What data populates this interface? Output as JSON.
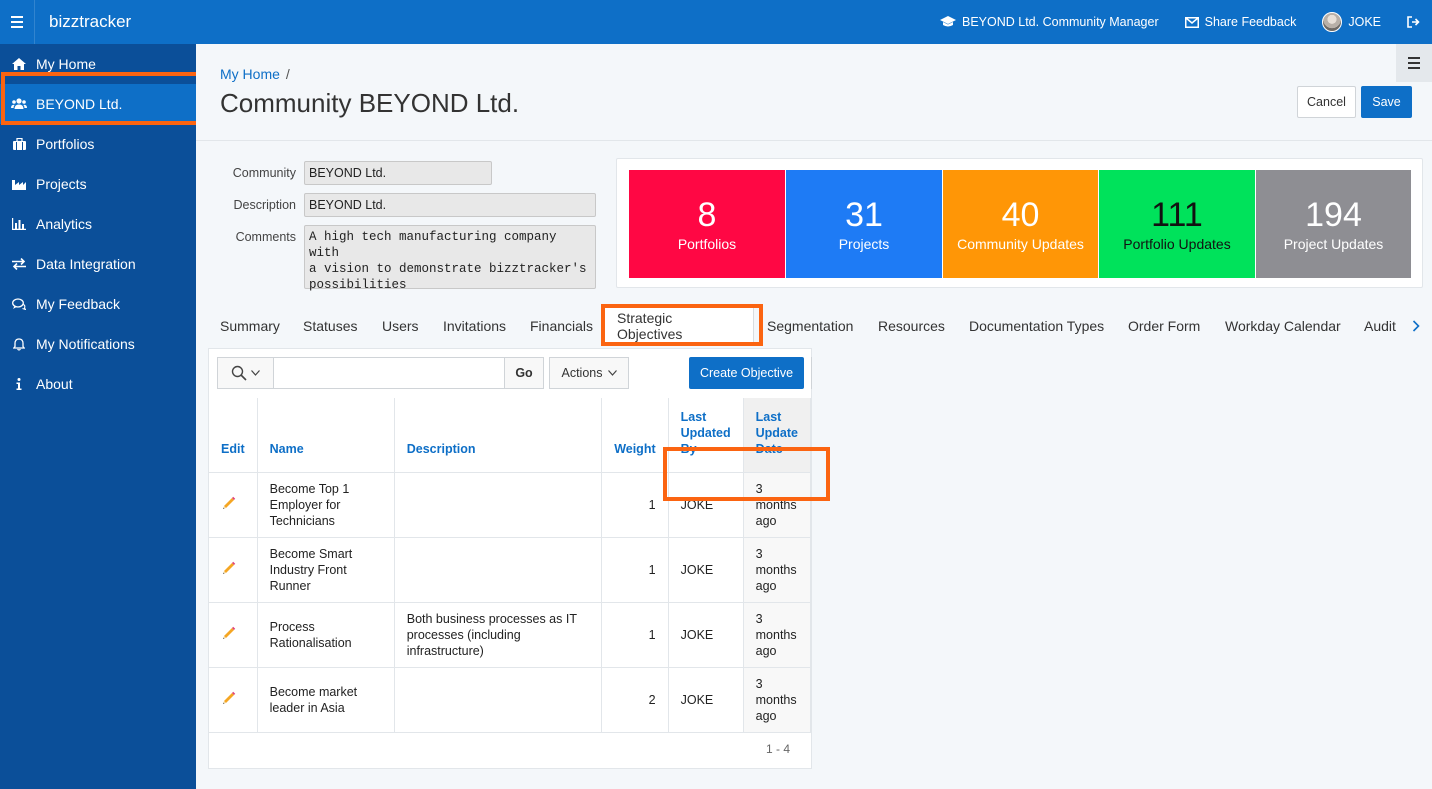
{
  "topbar": {
    "brand": "bizztracker",
    "role": "BEYOND Ltd. Community Manager",
    "feedback": "Share Feedback",
    "user": "JOKE"
  },
  "sidebar": {
    "items": [
      {
        "label": "My Home",
        "icon": "home-icon"
      },
      {
        "label": "BEYOND Ltd.",
        "icon": "users-icon"
      },
      {
        "label": "Portfolios",
        "icon": "briefcase-icon"
      },
      {
        "label": "Projects",
        "icon": "factory-icon"
      },
      {
        "label": "Analytics",
        "icon": "bar-chart-icon"
      },
      {
        "label": "Data Integration",
        "icon": "exchange-icon"
      },
      {
        "label": "My Feedback",
        "icon": "comments-icon"
      },
      {
        "label": "My Notifications",
        "icon": "bell-icon"
      },
      {
        "label": "About",
        "icon": "info-icon"
      }
    ]
  },
  "header": {
    "breadcrumb": "My Home",
    "breadcrumb_sep": "/",
    "title": "Community BEYOND Ltd.",
    "cancel": "Cancel",
    "save": "Save"
  },
  "form": {
    "community_label": "Community",
    "community_value": "BEYOND Ltd.",
    "description_label": "Description",
    "description_value": "BEYOND Ltd.",
    "comments_label": "Comments",
    "comments_value": "A high tech manufacturing company with\na vision to demonstrate bizztracker's\npossibilities"
  },
  "stats": [
    {
      "num": "8",
      "label": "Portfolios",
      "color": "#ff0744"
    },
    {
      "num": "31",
      "label": "Projects",
      "color": "#1e7bf5"
    },
    {
      "num": "40",
      "label": "Community Updates",
      "color": "#ff9606"
    },
    {
      "num": "111",
      "label": "Portfolio Updates",
      "color": "#00e25b"
    },
    {
      "num": "194",
      "label": "Project Updates",
      "color": "#8e8e93"
    }
  ],
  "tabs": [
    "Summary",
    "Statuses",
    "Users",
    "Invitations",
    "Financials",
    "Strategic Objectives",
    "Segmentation",
    "Resources",
    "Documentation Types",
    "Order Form",
    "Workday Calendar",
    "Audit"
  ],
  "report": {
    "go": "Go",
    "actions": "Actions",
    "create": "Create Objective",
    "columns": {
      "edit": "Edit",
      "name": "Name",
      "description": "Description",
      "weight": "Weight",
      "updated_by": "Last Updated By",
      "update_date": "Last Update Date"
    },
    "rows": [
      {
        "name": "Become Top 1 Employer for Technicians",
        "description": "",
        "weight": "1",
        "updated_by": "JOKE",
        "update_date": "3 months ago"
      },
      {
        "name": "Become Smart Industry Front Runner",
        "description": "",
        "weight": "1",
        "updated_by": "JOKE",
        "update_date": "3 months ago"
      },
      {
        "name": "Process Rationalisation",
        "description": "Both business processes as IT processes (including infrastructure)",
        "weight": "1",
        "updated_by": "JOKE",
        "update_date": "3 months ago"
      },
      {
        "name": "Become market leader in Asia",
        "description": "",
        "weight": "2",
        "updated_by": "JOKE",
        "update_date": "3 months ago"
      }
    ],
    "pagination": "1 - 4"
  },
  "colors": {
    "topbar": "#0e6fc7",
    "sidebar": "#0b4f99",
    "highlight": "#fb6411"
  }
}
